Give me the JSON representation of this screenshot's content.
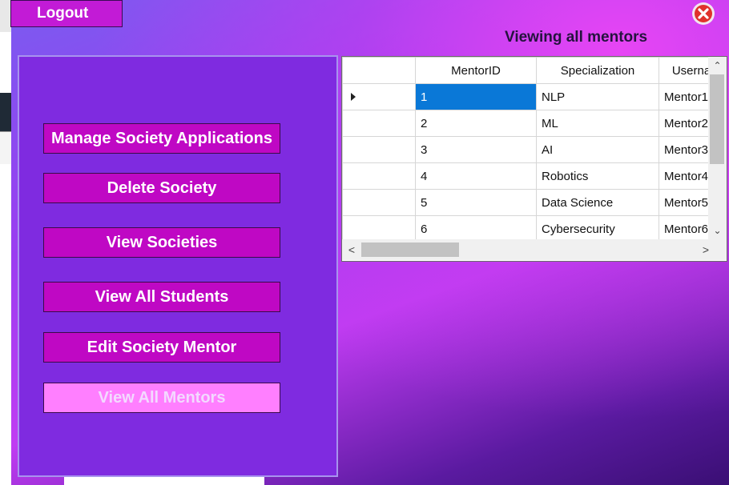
{
  "window": {
    "close_icon": "close-x-icon",
    "close_color": "#e0322c"
  },
  "header": {
    "logout_label": "Logout",
    "title": "Viewing all mentors"
  },
  "sidebar": {
    "buttons": [
      {
        "label": "Manage Society Applications",
        "active": false
      },
      {
        "label": "Delete Society",
        "active": false
      },
      {
        "label": "View Societies",
        "active": false
      },
      {
        "label": "View All Students",
        "active": false
      },
      {
        "label": "Edit Society Mentor",
        "active": false
      },
      {
        "label": "View All Mentors",
        "active": true
      }
    ],
    "active_color": "#ff7fff",
    "button_color": "#bf08c4"
  },
  "grid": {
    "columns": [
      "MentorID",
      "Specialization",
      "Userna"
    ],
    "rows": [
      {
        "id": "1",
        "specialization": "NLP",
        "username": "Mentor1"
      },
      {
        "id": "2",
        "specialization": "ML",
        "username": "Mentor2"
      },
      {
        "id": "3",
        "specialization": "AI",
        "username": "Mentor3"
      },
      {
        "id": "4",
        "specialization": "Robotics",
        "username": "Mentor4"
      },
      {
        "id": "5",
        "specialization": "Data Science",
        "username": "Mentor5"
      },
      {
        "id": "6",
        "specialization": "Cybersecurity",
        "username": "Mentor6"
      }
    ],
    "selected_row": 0,
    "selected_color": "#0a78d7"
  }
}
